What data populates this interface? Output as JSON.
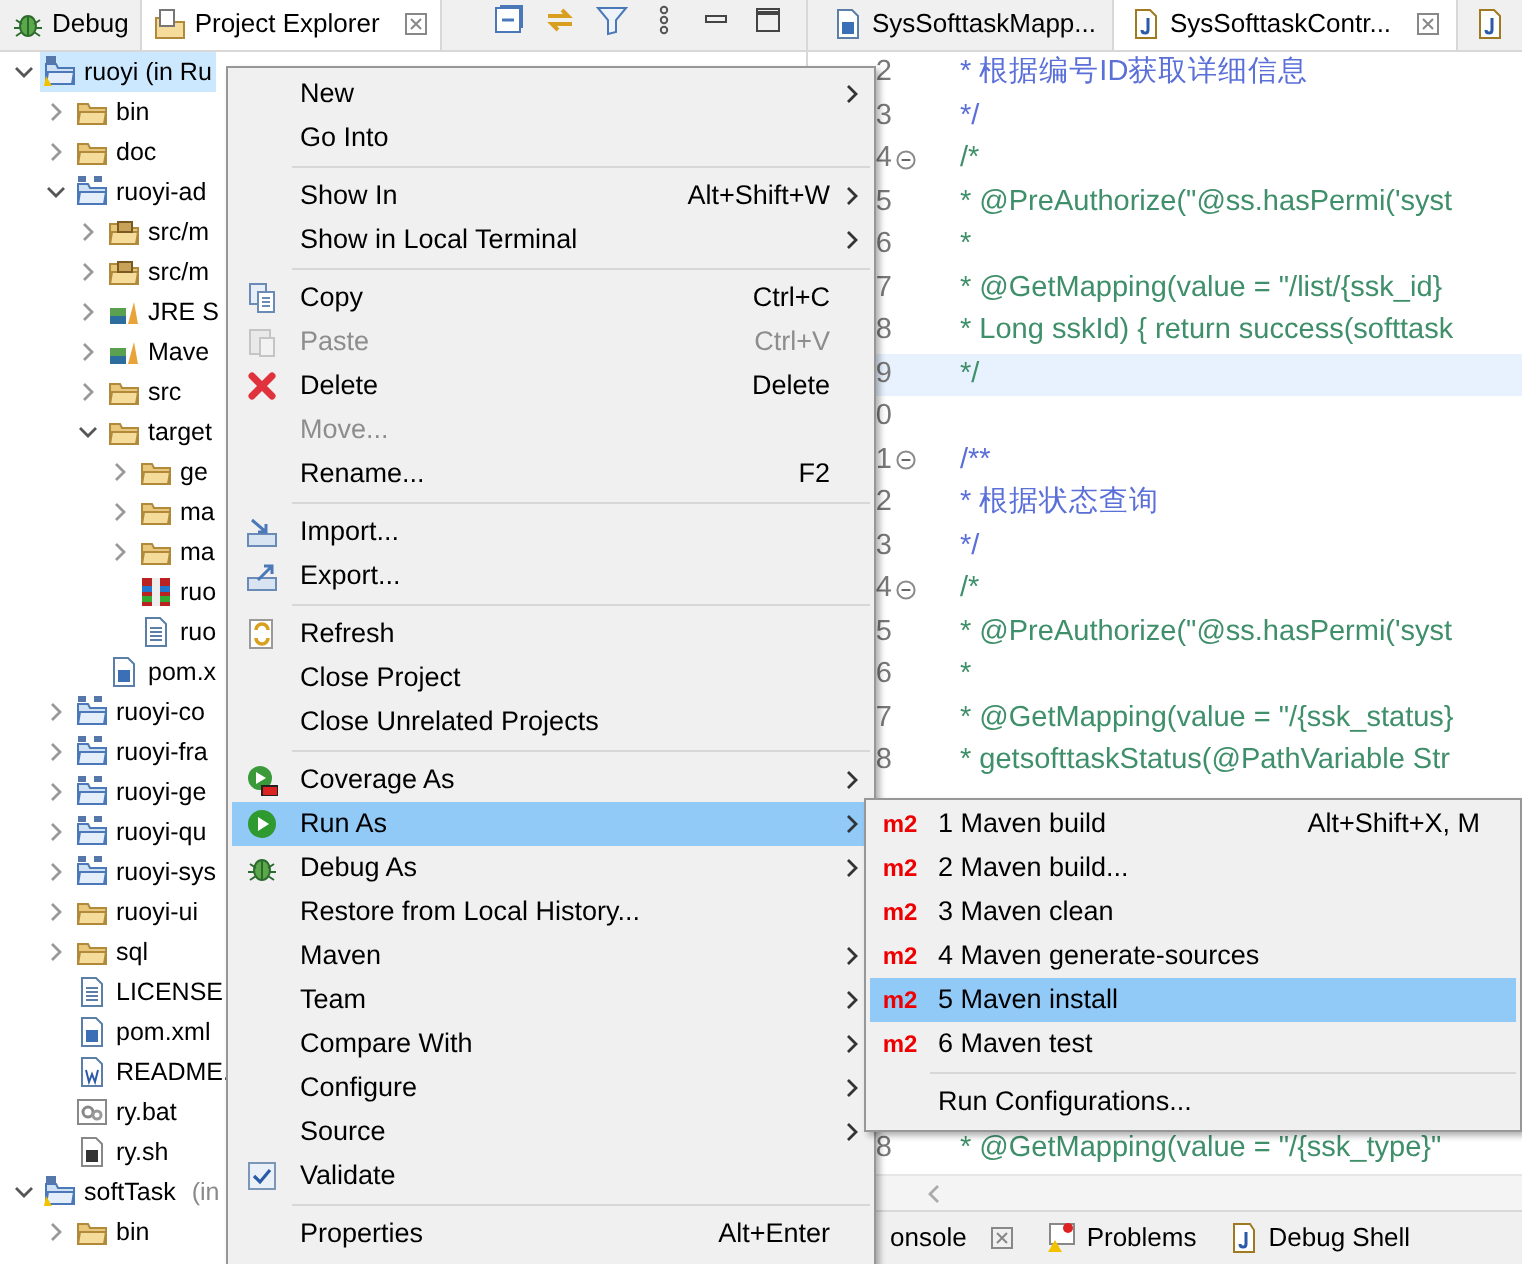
{
  "left_tabs": [
    {
      "label": "Debug",
      "kind": "bug",
      "selected": false,
      "closable": false
    },
    {
      "label": "Project Explorer",
      "kind": "explorer",
      "selected": true,
      "closable": true
    }
  ],
  "view_toolbar": [
    {
      "kind": "collapse"
    },
    {
      "kind": "link"
    },
    {
      "kind": "filter"
    },
    {
      "kind": "more"
    },
    {
      "kind": "minimize"
    },
    {
      "kind": "maximize"
    }
  ],
  "tree": [
    {
      "label": "ruoyi (in Ru",
      "kind": "project",
      "expanded": true,
      "selected": true,
      "children": [
        {
          "label": "bin",
          "kind": "folder",
          "expanded": false,
          "selected": false
        },
        {
          "label": "doc",
          "kind": "folder",
          "expanded": false,
          "selected": false
        },
        {
          "label": "ruoyi-ad",
          "kind": "module",
          "expanded": true,
          "selected": false,
          "children": [
            {
              "label": "src/m",
              "kind": "package",
              "expanded": false,
              "selected": false
            },
            {
              "label": "src/m",
              "kind": "package",
              "expanded": false,
              "selected": false
            },
            {
              "label": "JRE S",
              "kind": "library",
              "expanded": false,
              "selected": false
            },
            {
              "label": "Mave",
              "kind": "library",
              "expanded": false,
              "selected": false
            },
            {
              "label": "src",
              "kind": "folder",
              "expanded": false,
              "selected": false
            },
            {
              "label": "target",
              "kind": "folder",
              "expanded": true,
              "selected": false,
              "children": [
                {
                  "label": "ge",
                  "kind": "folder",
                  "expanded": false,
                  "selected": false
                },
                {
                  "label": "ma",
                  "kind": "folder",
                  "expanded": false,
                  "selected": false
                },
                {
                  "label": "ma",
                  "kind": "folder",
                  "expanded": false,
                  "selected": false
                },
                {
                  "label": "ruo",
                  "kind": "jar",
                  "selected": false
                },
                {
                  "label": "ruo",
                  "kind": "textfile",
                  "selected": false
                }
              ]
            },
            {
              "label": "pom.x",
              "kind": "xmlfile",
              "selected": false
            }
          ]
        },
        {
          "label": "ruoyi-co",
          "kind": "module",
          "expanded": false,
          "selected": false
        },
        {
          "label": "ruoyi-fra",
          "kind": "module",
          "expanded": false,
          "selected": false
        },
        {
          "label": "ruoyi-ge",
          "kind": "module",
          "expanded": false,
          "selected": false
        },
        {
          "label": "ruoyi-qu",
          "kind": "module",
          "expanded": false,
          "selected": false
        },
        {
          "label": "ruoyi-sys",
          "kind": "module",
          "expanded": false,
          "selected": false
        },
        {
          "label": "ruoyi-ui",
          "kind": "folder",
          "expanded": false,
          "selected": false
        },
        {
          "label": "sql",
          "kind": "folder",
          "expanded": false,
          "selected": false
        },
        {
          "label": "LICENSE",
          "kind": "textfile",
          "selected": false
        },
        {
          "label": "pom.xml",
          "kind": "xmlfile",
          "selected": false
        },
        {
          "label": "README.",
          "kind": "wordfile",
          "selected": false
        },
        {
          "label": "ry.bat",
          "kind": "batfile",
          "selected": false
        },
        {
          "label": "ry.sh",
          "kind": "shfile",
          "selected": false
        }
      ]
    },
    {
      "label": "softTask",
      "suffix": "(in",
      "kind": "project",
      "expanded": true,
      "selected": false,
      "children": [
        {
          "label": "bin",
          "kind": "folder",
          "expanded": false,
          "selected": false
        }
      ]
    }
  ],
  "editor_tabs": [
    {
      "label": "SysSofttaskMapp...",
      "kind": "xmlfile",
      "selected": false,
      "closable": false
    },
    {
      "label": "SysSofttaskContr...",
      "kind": "javafile",
      "selected": true,
      "closable": true
    },
    {
      "kind": "javafile",
      "selected": false
    }
  ],
  "code_lines": [
    {
      "number": "2",
      "text": "* 根据编号ID获取详细信息",
      "kind": "javadoc",
      "foldable": false,
      "highlighted": false
    },
    {
      "number": "3",
      "text": "*/",
      "kind": "javadoc",
      "foldable": false,
      "highlighted": false
    },
    {
      "number": "4",
      "text": "/*",
      "kind": "comment",
      "foldable": true,
      "highlighted": false
    },
    {
      "number": "5",
      "text": "* @PreAuthorize(\"@ss.hasPermi('syst",
      "kind": "comment",
      "foldable": false,
      "highlighted": false
    },
    {
      "number": "6",
      "text": "*",
      "kind": "comment",
      "foldable": false,
      "highlighted": false
    },
    {
      "number": "7",
      "text": "* @GetMapping(value = \"/list/{ssk_id}",
      "kind": "comment",
      "foldable": false,
      "highlighted": false
    },
    {
      "number": "8",
      "text": "* Long sskId) { return success(softtask",
      "kind": "comment",
      "foldable": false,
      "highlighted": false
    },
    {
      "number": "9",
      "text": "*/",
      "kind": "comment",
      "foldable": false,
      "highlighted": true
    },
    {
      "number": "0",
      "foldable": false,
      "highlighted": false
    },
    {
      "number": "1",
      "text": "/**",
      "kind": "javadoc",
      "foldable": true,
      "highlighted": false
    },
    {
      "number": "2",
      "text": "* 根据状态查询",
      "kind": "javadoc",
      "foldable": false,
      "highlighted": false
    },
    {
      "number": "3",
      "text": "*/",
      "kind": "javadoc",
      "foldable": false,
      "highlighted": false
    },
    {
      "number": "4",
      "text": "/*",
      "kind": "comment",
      "foldable": true,
      "highlighted": false
    },
    {
      "number": "5",
      "text": "* @PreAuthorize(\"@ss.hasPermi('syst",
      "kind": "comment",
      "foldable": false,
      "highlighted": false
    },
    {
      "number": "6",
      "text": "*",
      "kind": "comment",
      "foldable": false,
      "highlighted": false
    },
    {
      "number": "7",
      "text": "* @GetMapping(value = \"/{ssk_status}",
      "kind": "comment",
      "foldable": false,
      "highlighted": false
    },
    {
      "number": "8",
      "text": "* getsofttaskStatus(@PathVariable Str",
      "kind": "comment",
      "foldable": false,
      "highlighted": false
    }
  ],
  "code_lines_below_menu": [
    {
      "number": "8",
      "text": "* @GetMapping(value = \"/{ssk_type}\"",
      "kind": "comment",
      "foldable": false,
      "highlighted": false
    }
  ],
  "bottom_tabs": [
    {
      "label": "onsole",
      "kind": "console",
      "closable": true
    },
    {
      "label": "Problems",
      "kind": "problems",
      "closable": false
    },
    {
      "label": "Debug Shell",
      "kind": "debugshell",
      "closable": false
    }
  ],
  "context_menu": [
    {
      "kind": "plain",
      "label": "New",
      "submenu": true,
      "disabled": false,
      "selected": false
    },
    {
      "kind": "plain",
      "label": "Go Into",
      "submenu": false,
      "disabled": false,
      "selected": false
    },
    {
      "kind": "separator"
    },
    {
      "kind": "plain",
      "label": "Show In",
      "shortcut": "Alt+Shift+W",
      "submenu": true,
      "disabled": false,
      "selected": false
    },
    {
      "kind": "plain",
      "label": "Show in Local Terminal",
      "submenu": true,
      "disabled": false,
      "selected": false
    },
    {
      "kind": "separator"
    },
    {
      "kind": "copy",
      "label": "Copy",
      "shortcut": "Ctrl+C",
      "submenu": false,
      "disabled": false,
      "selected": false
    },
    {
      "kind": "paste",
      "label": "Paste",
      "shortcut": "Ctrl+V",
      "submenu": false,
      "disabled": true,
      "selected": false
    },
    {
      "kind": "delete",
      "label": "Delete",
      "shortcut": "Delete",
      "submenu": false,
      "disabled": false,
      "selected": false
    },
    {
      "kind": "plain",
      "label": "Move...",
      "submenu": false,
      "disabled": true,
      "selected": false
    },
    {
      "kind": "plain",
      "label": "Rename...",
      "shortcut": "F2",
      "submenu": false,
      "disabled": false,
      "selected": false
    },
    {
      "kind": "separator"
    },
    {
      "kind": "import",
      "label": "Import...",
      "submenu": false,
      "disabled": false,
      "selected": false
    },
    {
      "kind": "export",
      "label": "Export...",
      "submenu": false,
      "disabled": false,
      "selected": false
    },
    {
      "kind": "separator"
    },
    {
      "kind": "refresh",
      "label": "Refresh",
      "submenu": false,
      "disabled": false,
      "selected": false
    },
    {
      "kind": "plain",
      "label": "Close Project",
      "submenu": false,
      "disabled": false,
      "selected": false
    },
    {
      "kind": "plain",
      "label": "Close Unrelated Projects",
      "submenu": false,
      "disabled": false,
      "selected": false
    },
    {
      "kind": "separator"
    },
    {
      "kind": "coverage",
      "label": "Coverage As",
      "submenu": true,
      "disabled": false,
      "selected": false
    },
    {
      "kind": "run",
      "label": "Run As",
      "submenu": true,
      "disabled": false,
      "selected": true
    },
    {
      "kind": "bug",
      "label": "Debug As",
      "submenu": true,
      "disabled": false,
      "selected": false
    },
    {
      "kind": "plain",
      "label": "Restore from Local History...",
      "submenu": false,
      "disabled": false,
      "selected": false
    },
    {
      "kind": "plain",
      "label": "Maven",
      "submenu": true,
      "disabled": false,
      "selected": false
    },
    {
      "kind": "plain",
      "label": "Team",
      "submenu": true,
      "disabled": false,
      "selected": false
    },
    {
      "kind": "plain",
      "label": "Compare With",
      "submenu": true,
      "disabled": false,
      "selected": false
    },
    {
      "kind": "plain",
      "label": "Configure",
      "submenu": true,
      "disabled": false,
      "selected": false
    },
    {
      "kind": "plain",
      "label": "Source",
      "submenu": true,
      "disabled": false,
      "selected": false
    },
    {
      "kind": "check",
      "label": "Validate",
      "submenu": false,
      "disabled": false,
      "selected": false
    },
    {
      "kind": "separator"
    },
    {
      "kind": "plain",
      "label": "Properties",
      "shortcut": "Alt+Enter",
      "submenu": false,
      "disabled": false,
      "selected": false
    }
  ],
  "run_as_menu": [
    {
      "kind": "item",
      "badge": "m2",
      "label": "1 Maven build",
      "shortcut": "Alt+Shift+X, M",
      "selected": false
    },
    {
      "kind": "item",
      "badge": "m2",
      "label": "2 Maven build...",
      "selected": false
    },
    {
      "kind": "item",
      "badge": "m2",
      "label": "3 Maven clean",
      "selected": false
    },
    {
      "kind": "item",
      "badge": "m2",
      "label": "4 Maven generate-sources",
      "selected": false
    },
    {
      "kind": "item",
      "badge": "m2",
      "label": "5 Maven install",
      "selected": true
    },
    {
      "kind": "item",
      "badge": "m2",
      "label": "6 Maven test",
      "selected": false
    },
    {
      "kind": "separator"
    },
    {
      "kind": "item",
      "label": "Run Configurations...",
      "selected": false
    }
  ]
}
